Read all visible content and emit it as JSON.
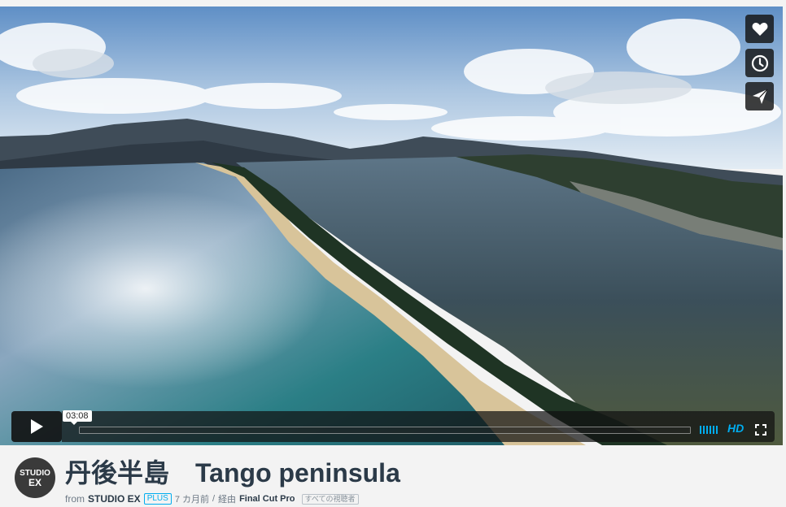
{
  "player": {
    "current_time": "03:08",
    "hd_label": "HD",
    "side_buttons": [
      "heart-icon",
      "clock-icon",
      "send-icon"
    ],
    "accent_color": "#00adef"
  },
  "video": {
    "title": "丹後半島　Tango peninsula",
    "from_label": "from",
    "author": "STUDIO EX",
    "plus_badge": "PLUS",
    "age": "7 カ月前",
    "separator": "/",
    "via_label": "経由",
    "via_app": "Final Cut Pro",
    "audience": "すべての視聴者"
  },
  "avatar": {
    "line1": "STUDIO",
    "line2": "EX"
  }
}
